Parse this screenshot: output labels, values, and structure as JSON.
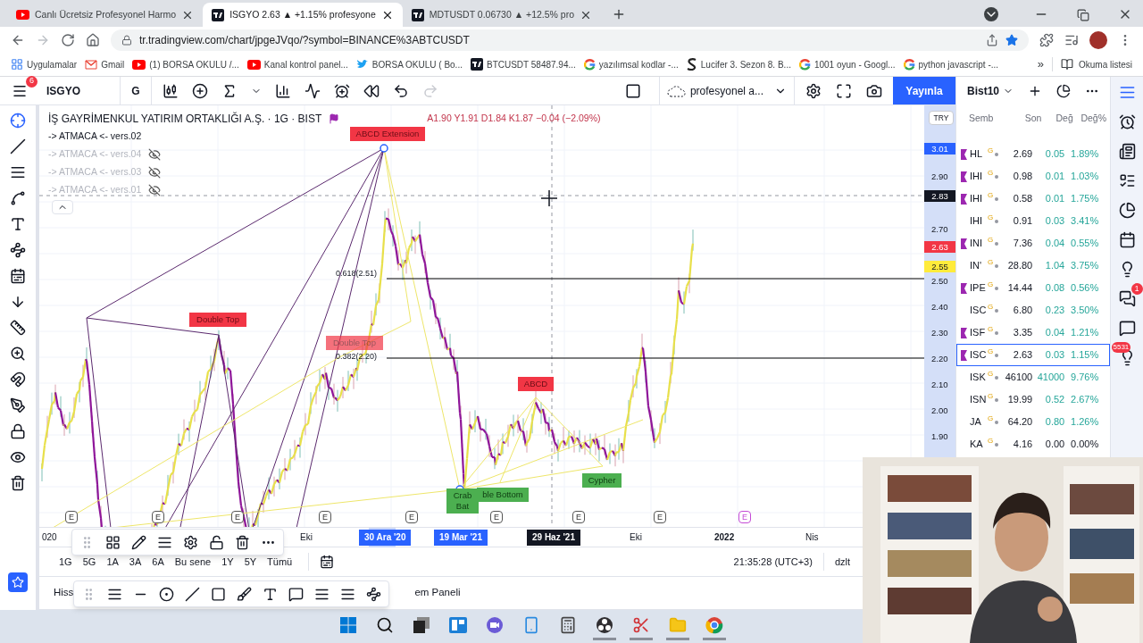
{
  "browser": {
    "tabs": [
      {
        "title": "Canlı Ücretsiz Profesyonel Harmo",
        "selected": false
      },
      {
        "title": "ISGYO 2.63 ▲ +1.15% profesyone",
        "selected": true
      },
      {
        "title": "MDTUSDT 0.06730 ▲ +12.5% pro",
        "selected": false
      }
    ],
    "url": "tr.tradingview.com/chart/jpgeJVqo/?symbol=BINANCE%3ABTCUSDT",
    "bookmarks": [
      {
        "label": "Uygulamalar"
      },
      {
        "label": "Gmail"
      },
      {
        "label": "(1) BORSA OKULU /..."
      },
      {
        "label": "Kanal kontrol panel..."
      },
      {
        "label": "BORSA OKULU ( Bo..."
      },
      {
        "label": "BTCUSDT 58487.94..."
      },
      {
        "label": "yazılımsal kodlar -..."
      },
      {
        "label": "Lucifer 3. Sezon 8. B..."
      },
      {
        "label": "1001 oyun - Googl..."
      },
      {
        "label": "python javascript -..."
      }
    ],
    "bookmarks_more": "»",
    "reading_list": "Okuma listesi"
  },
  "toolbar": {
    "menu_badge": "6",
    "symbol": "ISGYO",
    "interval": "G",
    "layout_name": "profesyonel a...",
    "publish": "Yayınla"
  },
  "chart": {
    "title": "İŞ GAYRİMENKUL YATIRIM ORTAKLIĞI A.Ş. · 1G · BIST",
    "flagged": true,
    "ohlc": "A1.90 Y1.91 D1.84 K1.87 −0.04 (−2.09%)",
    "indicators": [
      {
        "label": "-> ATMACA <- vers.02",
        "visible": true
      },
      {
        "label": "-> ATMACA <- vers.04",
        "visible": false
      },
      {
        "label": "-> ATMACA <- vers.03",
        "visible": false
      },
      {
        "label": "-> ATMACA <- vers.01",
        "visible": false
      }
    ],
    "annotations": [
      {
        "label": "ABCD Extension",
        "kind": "bearish",
        "faded": false
      },
      {
        "label": "Double Top",
        "kind": "bearish",
        "faded": false
      },
      {
        "label": "Double Top",
        "kind": "bearish",
        "faded": true
      },
      {
        "label": "ABCD",
        "kind": "bearish",
        "faded": false
      },
      {
        "label": "ble Bottom",
        "kind": "bullish",
        "faded": false
      },
      {
        "label": "Crab Bat",
        "kind": "bullish",
        "faded": false
      },
      {
        "label": "Cypher",
        "kind": "bullish",
        "faded": false
      }
    ],
    "levels": [
      {
        "label": "0.618(2.51)"
      },
      {
        "label": "0.382(2.20)"
      }
    ],
    "earnings_markers": [
      {
        "label": "E",
        "highlighted": false
      },
      {
        "label": "E",
        "highlighted": false
      },
      {
        "label": "E",
        "highlighted": false
      },
      {
        "label": "E",
        "highlighted": false
      },
      {
        "label": "E",
        "highlighted": false
      },
      {
        "label": "E",
        "highlighted": false
      },
      {
        "label": "E",
        "highlighted": false
      },
      {
        "label": "E",
        "highlighted": false
      },
      {
        "label": "E",
        "highlighted": true
      }
    ]
  },
  "price_axis": {
    "currency": "TRY",
    "ticks": [
      "2.90",
      "2.70",
      "2.50",
      "2.40",
      "2.30",
      "2.20",
      "2.10",
      "2.00",
      "1.90"
    ],
    "badges": [
      {
        "value": "3.01",
        "kind": "high"
      },
      {
        "value": "2.83",
        "kind": "crosshair"
      },
      {
        "value": "2.63",
        "kind": "last"
      },
      {
        "value": "2.55",
        "kind": "marker"
      }
    ]
  },
  "time_axis": [
    {
      "label": "020",
      "kind": "plain"
    },
    {
      "label": "Eki",
      "kind": "plain"
    },
    {
      "label": "30 Ara '20",
      "kind": "range"
    },
    {
      "label": "19 Mar '21",
      "kind": "range"
    },
    {
      "label": "29 Haz '21",
      "kind": "cursor"
    },
    {
      "label": "Eki",
      "kind": "plain"
    },
    {
      "label": "2022",
      "kind": "year"
    },
    {
      "label": "Nis",
      "kind": "plain"
    }
  ],
  "range_bar": {
    "ranges": [
      "1G",
      "5G",
      "1A",
      "3A",
      "6A",
      "Bu sene",
      "1Y",
      "5Y",
      "Tümü"
    ],
    "clock": "21:35:28 (UTC+3)",
    "adjust": "dzlt"
  },
  "bottom_panel": {
    "left_label": "Hiss",
    "right_label": "em Paneli"
  },
  "watchlist": {
    "name": "Bist10",
    "columns": [
      "Semb",
      "Son",
      "Değ",
      "Değ%"
    ],
    "rows": [
      {
        "symbol": "HL",
        "tag": "G",
        "flagged": true,
        "last": "2.69",
        "change": "0.05",
        "change_pct": "1.89%",
        "kind": "gain",
        "selected": false
      },
      {
        "symbol": "IHI",
        "tag": "G",
        "flagged": true,
        "last": "0.98",
        "change": "0.01",
        "change_pct": "1.03%",
        "kind": "gain",
        "selected": false
      },
      {
        "symbol": "IHI",
        "tag": "G",
        "flagged": true,
        "last": "0.58",
        "change": "0.01",
        "change_pct": "1.75%",
        "kind": "gain",
        "selected": false
      },
      {
        "symbol": "IHI",
        "tag": "G",
        "flagged": false,
        "last": "0.91",
        "change": "0.03",
        "change_pct": "3.41%",
        "kind": "gain",
        "selected": false
      },
      {
        "symbol": "INI",
        "tag": "G",
        "flagged": true,
        "last": "7.36",
        "change": "0.04",
        "change_pct": "0.55%",
        "kind": "gain",
        "selected": false
      },
      {
        "symbol": "IN'",
        "tag": "G",
        "flagged": false,
        "last": "28.80",
        "change": "1.04",
        "change_pct": "3.75%",
        "kind": "gain",
        "selected": false
      },
      {
        "symbol": "IPE",
        "tag": "G",
        "flagged": true,
        "last": "14.44",
        "change": "0.08",
        "change_pct": "0.56%",
        "kind": "gain",
        "selected": false
      },
      {
        "symbol": "ISC",
        "tag": "G",
        "flagged": false,
        "last": "6.80",
        "change": "0.23",
        "change_pct": "3.50%",
        "kind": "gain",
        "selected": false
      },
      {
        "symbol": "ISF",
        "tag": "G",
        "flagged": true,
        "last": "3.35",
        "change": "0.04",
        "change_pct": "1.21%",
        "kind": "gain",
        "selected": false
      },
      {
        "symbol": "ISC",
        "tag": "G",
        "flagged": true,
        "last": "2.63",
        "change": "0.03",
        "change_pct": "1.15%",
        "kind": "gain",
        "selected": true
      },
      {
        "symbol": "ISK",
        "tag": "G",
        "flagged": false,
        "last": "46100",
        "change": "41000",
        "change_pct": "9.76%",
        "kind": "gain",
        "selected": false
      },
      {
        "symbol": "ISN",
        "tag": "G",
        "flagged": false,
        "last": "19.99",
        "change": "0.52",
        "change_pct": "2.67%",
        "kind": "gain",
        "selected": false
      },
      {
        "symbol": "JA",
        "tag": "G",
        "flagged": false,
        "last": "64.20",
        "change": "0.80",
        "change_pct": "1.26%",
        "kind": "gain",
        "selected": false
      },
      {
        "symbol": "KA",
        "tag": "G",
        "flagged": false,
        "last": "4.16",
        "change": "0.00",
        "change_pct": "0.00%",
        "kind": "unchanged",
        "selected": false
      }
    ]
  },
  "side_badges": {
    "chat": "1",
    "ideas": "5531"
  },
  "taskbar": [
    {
      "kind": "start",
      "running": false
    },
    {
      "kind": "search",
      "running": false
    },
    {
      "kind": "taskview",
      "running": false
    },
    {
      "kind": "widgets",
      "running": false
    },
    {
      "kind": "chat",
      "running": false
    },
    {
      "kind": "phone",
      "running": false
    },
    {
      "kind": "calculator",
      "running": false
    },
    {
      "kind": "recorder",
      "running": true
    },
    {
      "kind": "snip",
      "running": true
    },
    {
      "kind": "folder",
      "running": true
    },
    {
      "kind": "browser",
      "running": true
    }
  ]
}
